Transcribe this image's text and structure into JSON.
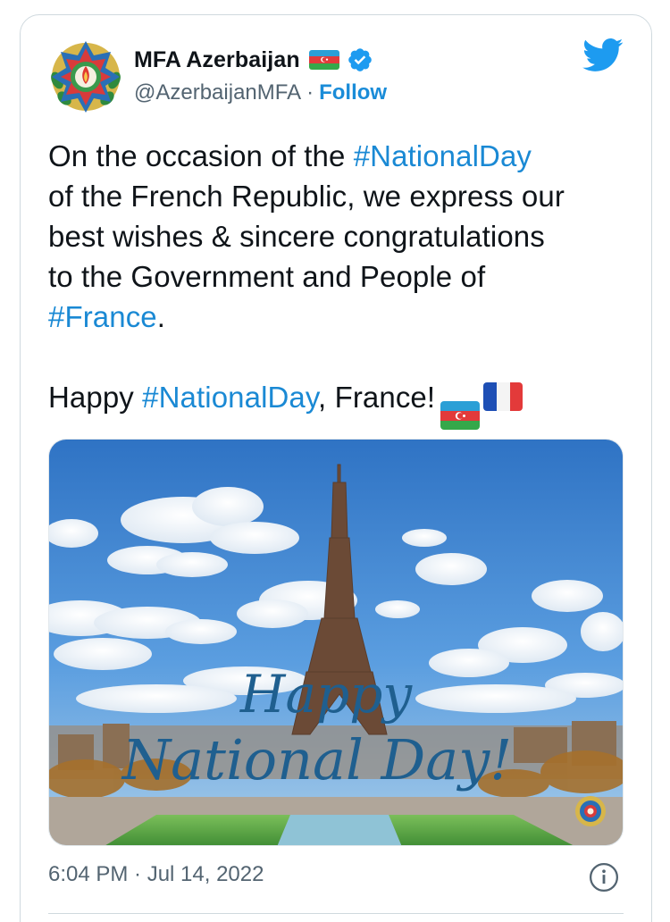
{
  "account": {
    "name": "MFA Azerbaijan",
    "handle": "@AzerbaijanMFA",
    "separator": "·",
    "follow_label": "Follow",
    "avatar_icon": "azerbaijan-emblem-icon",
    "verified_icon": "verified-badge-icon",
    "flag_icon": "azerbaijan-flag-icon"
  },
  "platform": {
    "logo_icon": "twitter-bird-icon",
    "brand_color": "#1d9bf0"
  },
  "tweet": {
    "line1_pre": "On the occasion of the ",
    "hashtag1": "#NationalDay",
    "line2": "of the French Republic, we express our",
    "line3": "best wishes & sincere congratulations",
    "line4": "to the Government and People of",
    "hashtag2": "#France",
    "line5_post": ".",
    "happy_pre": "Happy ",
    "hashtag3": "#NationalDay",
    "happy_post": ", France!",
    "flags": [
      "azerbaijan-flag-icon",
      "france-flag-icon"
    ]
  },
  "media": {
    "description_icon": "eiffel-tower-photo",
    "overlay_line1": "Happy",
    "overlay_line2": "National Day!"
  },
  "footer": {
    "timestamp": "6:04 PM · Jul 14, 2022",
    "info_icon": "info-icon"
  }
}
